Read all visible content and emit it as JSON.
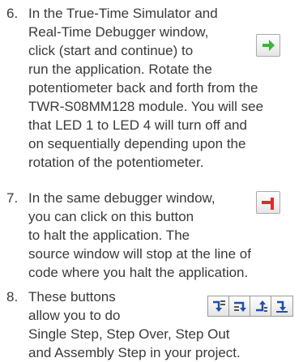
{
  "steps": [
    {
      "number": "6.",
      "lines": [
        "In the True-Time Simulator and",
        "Real-Time Debugger window,",
        "click (start and continue) to",
        "run the application. Rotate the",
        "potentiometer back and forth from the",
        "TWR-S08MM128 module. You will see",
        "that LED 1 to LED 4 will turn off and",
        "on sequentially depending upon the",
        "rotation of the potentiometer."
      ],
      "icon": "start-continue-green-arrow-icon"
    },
    {
      "number": "7.",
      "lines": [
        "In the same debugger window,",
        "you can click on this button",
        "to halt the application. The",
        "source window will stop at the line of",
        "code where you halt the application."
      ],
      "icon": "halt-red-icon"
    },
    {
      "number": "8.",
      "lines": [
        "These buttons",
        "allow you to do",
        "Single Step, Step Over, Step Out",
        "and Assembly Step in your project."
      ],
      "icons": [
        "single-step-icon",
        "step-over-icon",
        "step-out-icon",
        "assembly-step-icon"
      ]
    }
  ],
  "colors": {
    "text": "#3a3a3a",
    "start_arrow": "#3cb43c",
    "halt": "#e02a2a",
    "step_icons": "#1f4fa8"
  }
}
